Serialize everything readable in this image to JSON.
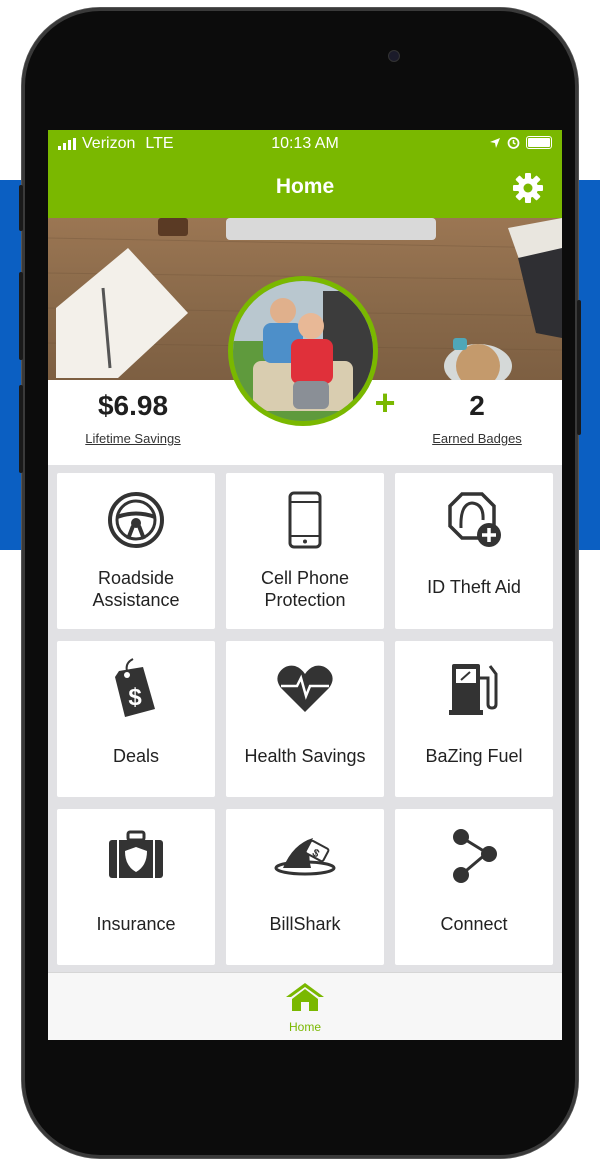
{
  "status_bar": {
    "carrier": "Verizon",
    "network": "LTE",
    "time": "10:13 AM"
  },
  "header": {
    "title": "Home",
    "settings_icon": "gear-icon"
  },
  "stats": {
    "savings_value": "$6.98",
    "savings_label": "Lifetime Savings",
    "badges_value": "2",
    "badges_label": "Earned Badges",
    "add_photo": "+"
  },
  "tiles": [
    {
      "label": "Roadside Assistance",
      "icon": "steering-wheel-icon"
    },
    {
      "label": "Cell Phone Protection",
      "icon": "cell-phone-icon"
    },
    {
      "label": "ID Theft Aid",
      "icon": "id-theft-icon"
    },
    {
      "label": "Deals",
      "icon": "price-tag-icon"
    },
    {
      "label": "Health Savings",
      "icon": "heart-pulse-icon"
    },
    {
      "label": "BaZing Fuel",
      "icon": "fuel-pump-icon"
    },
    {
      "label": "Insurance",
      "icon": "insurance-case-icon"
    },
    {
      "label": "BillShark",
      "icon": "shark-fin-icon"
    },
    {
      "label": "Connect",
      "icon": "share-network-icon"
    }
  ],
  "tab_bar": {
    "home_label": "Home"
  },
  "colors": {
    "brand_green": "#7ab800",
    "background_blue": "#0b5fc2"
  }
}
